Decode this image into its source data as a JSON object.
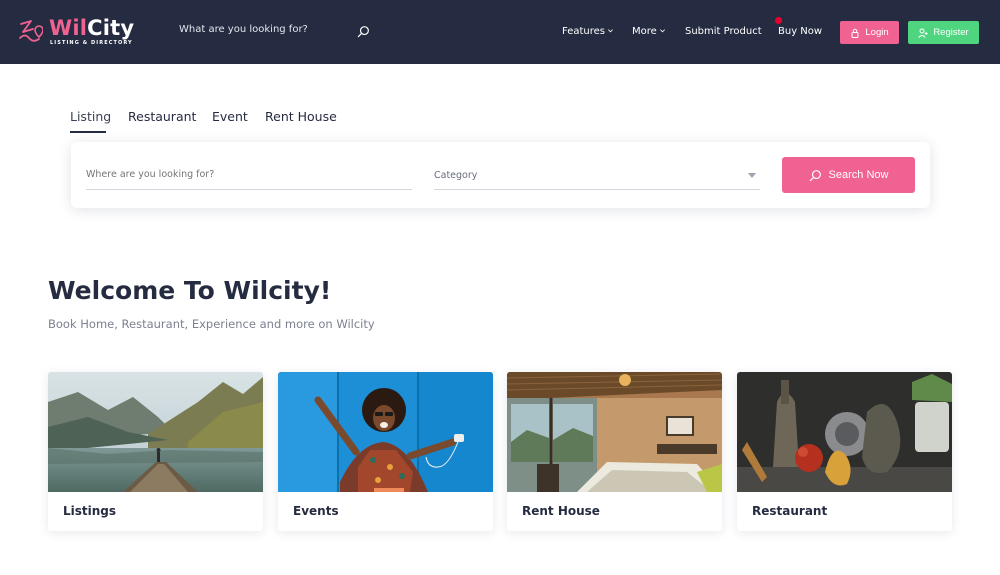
{
  "header": {
    "logo": {
      "brand_first": "Wil",
      "brand_second": "City",
      "tagline": "LISTING & DIRECTORY"
    },
    "search_placeholder": "What are you looking for?",
    "nav": {
      "features": "Features",
      "more": "More",
      "submit_product": "Submit Product",
      "buy_now": "Buy Now"
    },
    "login_label": "Login",
    "register_label": "Register"
  },
  "tabs": [
    {
      "label": "Listing",
      "active": true
    },
    {
      "label": "Restaurant",
      "active": false
    },
    {
      "label": "Event",
      "active": false
    },
    {
      "label": "Rent House",
      "active": false
    }
  ],
  "search_panel": {
    "where_placeholder": "Where are you looking for?",
    "category_label": "Category",
    "button_label": "Search Now"
  },
  "welcome": {
    "title": "Welcome To Wilcity!",
    "subtitle": "Book Home, Restaurant, Experience and more on Wilcity"
  },
  "cards": [
    {
      "label": "Listings"
    },
    {
      "label": "Events"
    },
    {
      "label": "Rent House"
    },
    {
      "label": "Restaurant"
    }
  ],
  "colors": {
    "header_bg": "#252c41",
    "brand_pink": "#f06292",
    "register_green": "#4fd57f",
    "buy_now_dot": "#e8002d"
  }
}
